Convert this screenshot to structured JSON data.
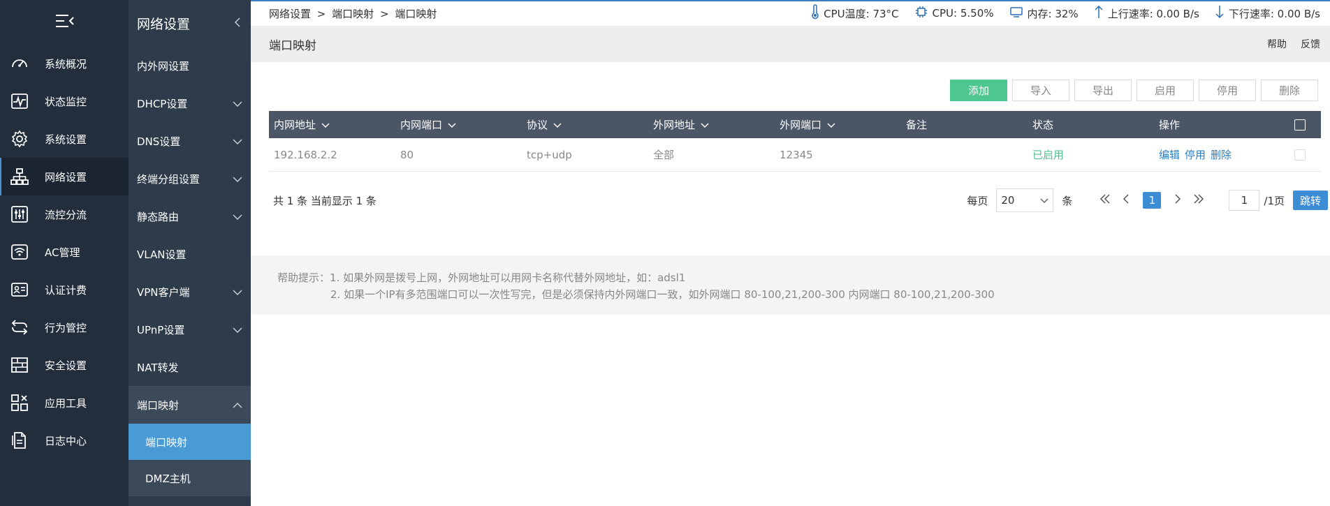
{
  "nav1": {
    "items": [
      {
        "label": "系统概况",
        "icon": "dashboard-icon"
      },
      {
        "label": "状态监控",
        "icon": "monitor-icon"
      },
      {
        "label": "系统设置",
        "icon": "gear-icon"
      },
      {
        "label": "网络设置",
        "icon": "network-icon"
      },
      {
        "label": "流控分流",
        "icon": "sliders-icon"
      },
      {
        "label": "AC管理",
        "icon": "wifi-icon"
      },
      {
        "label": "认证计费",
        "icon": "id-card-icon"
      },
      {
        "label": "行为管控",
        "icon": "arrows-icon"
      },
      {
        "label": "安全设置",
        "icon": "firewall-icon"
      },
      {
        "label": "应用工具",
        "icon": "apps-icon"
      },
      {
        "label": "日志中心",
        "icon": "document-icon"
      }
    ]
  },
  "nav2": {
    "title": "网络设置",
    "items": [
      {
        "label": "内外网设置"
      },
      {
        "label": "DHCP设置"
      },
      {
        "label": "DNS设置"
      },
      {
        "label": "终端分组设置"
      },
      {
        "label": "静态路由"
      },
      {
        "label": "VLAN设置"
      },
      {
        "label": "VPN客户端"
      },
      {
        "label": "UPnP设置"
      },
      {
        "label": "NAT转发"
      },
      {
        "label": "端口映射"
      }
    ],
    "subitems": [
      {
        "label": "端口映射"
      },
      {
        "label": "DMZ主机"
      }
    ]
  },
  "topbar": {
    "breadcrumb": [
      "网络设置",
      "端口映射",
      "端口映射"
    ],
    "separator": ">",
    "cpu_temp": "CPU温度: 73°C",
    "cpu": "CPU: 5.50%",
    "memory": "内存: 32%",
    "upload": "上行速率: 0.00 B/s",
    "download": "下行速率: 0.00 B/s"
  },
  "titlebar": {
    "title": "端口映射",
    "help": "帮助",
    "feedback": "反馈"
  },
  "toolbar": {
    "add": "添加",
    "import": "导入",
    "export": "导出",
    "enable": "启用",
    "disable": "停用",
    "delete": "删除"
  },
  "table": {
    "headers": [
      "内网地址",
      "内网端口",
      "协议",
      "外网地址",
      "外网端口",
      "备注",
      "状态",
      "操作"
    ],
    "rows": [
      {
        "lan_ip": "192.168.2.2",
        "lan_port": "80",
        "protocol": "tcp+udp",
        "wan_ip": "全部",
        "wan_port": "12345",
        "note": "",
        "status": "已启用",
        "ops": [
          "编辑",
          "停用",
          "删除"
        ]
      }
    ]
  },
  "pager": {
    "total": "共 1 条 当前显示 1 条",
    "per_page_label": "每页",
    "per_page_value": "20",
    "unit": "条",
    "current_page": "1",
    "page_input": "1",
    "total_pages": "/1页",
    "jump": "跳转"
  },
  "help": {
    "line1": "帮助提示：1. 如果外网是拨号上网，外网地址可以用网卡名称代替外网地址，如：adsl1",
    "line2": "2. 如果一个IP有多范围端口可以一次性写完，但是必须保持内外网端口一致，如外网端口 80-100,21,200-300 内网端口 80-100,21,200-300"
  },
  "colors": {
    "nav1_bg": "#222e3c",
    "nav2_bg": "#2e3b4a",
    "accent_blue": "#4a9ad6",
    "add_green": "#4dc68f",
    "status_green": "#4cc08d",
    "table_header": "#4a5566"
  }
}
